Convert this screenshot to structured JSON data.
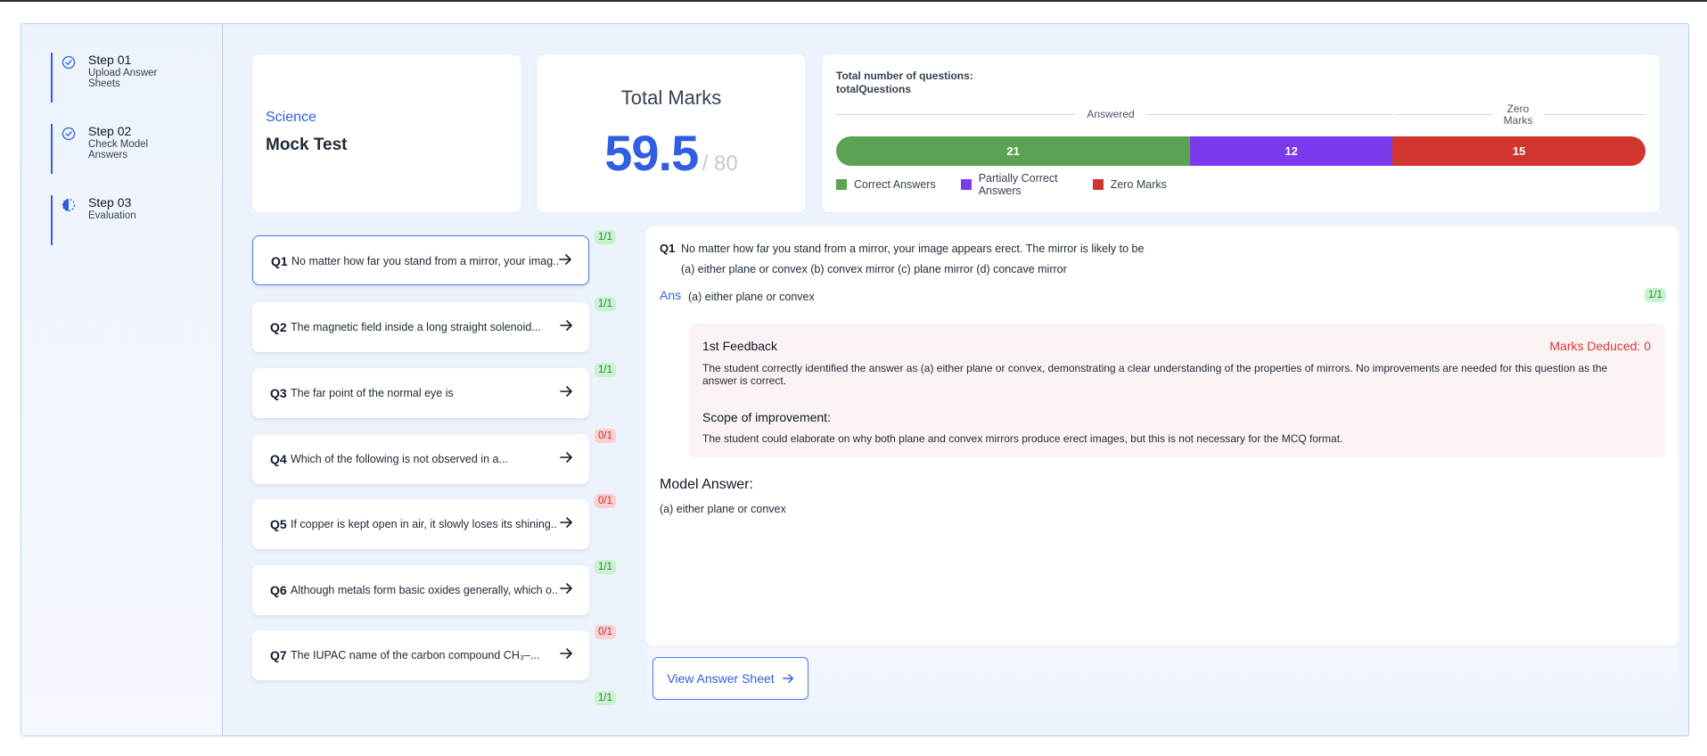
{
  "steps": [
    {
      "title": "Step 01",
      "subtitle": "Upload Answer Sheets",
      "icon": "check-circle-icon"
    },
    {
      "title": "Step 02",
      "subtitle": "Check Model Answers",
      "icon": "check-circle-icon"
    },
    {
      "title": "Step 03",
      "subtitle": "Evaluation",
      "icon": "half-circle-progress-icon"
    }
  ],
  "summary": {
    "subject": "Science",
    "test_name": "Mock Test",
    "total_marks_label": "Total Marks",
    "score": "59.5",
    "out_of": "/ 80"
  },
  "stats": {
    "line1": "Total number of questions:",
    "line2": "totalQuestions",
    "answered_label": "Answered",
    "zero_label": "Zero Marks",
    "bar": [
      {
        "name": "Correct Answers",
        "value": 21,
        "color": "#5ba353"
      },
      {
        "name": "Partially Correct Answers",
        "value": 12,
        "color": "#7c3aed"
      },
      {
        "name": "Zero Marks",
        "value": 15,
        "color": "#d0362e"
      }
    ],
    "legend": [
      "Correct Answers",
      "Partially Correct Answers",
      "Zero Marks"
    ]
  },
  "questions": [
    {
      "num": "Q1",
      "text": "No matter how far you stand from a mirror, your imag...",
      "badge": "1/1",
      "status": "ok"
    },
    {
      "num": "Q2",
      "text": "The magnetic field inside a long straight solenoid...",
      "badge": "1/1",
      "status": "ok"
    },
    {
      "num": "Q3",
      "text": "The far point of the normal eye is",
      "badge": "1/1",
      "status": "ok"
    },
    {
      "num": "Q4",
      "text": "Which of the following is not observed in a...",
      "badge": "0/1",
      "status": "zero"
    },
    {
      "num": "Q5",
      "text": "If copper is kept open in air, it slowly loses its shining...",
      "badge": "0/1",
      "status": "zero"
    },
    {
      "num": "Q6",
      "text": "Although metals form basic oxides generally, which o...",
      "badge": "1/1",
      "status": "ok"
    },
    {
      "num": "Q7",
      "text": "The IUPAC name of the carbon compound CH₃–...",
      "badge": "0/1",
      "status": "zero"
    },
    {
      "badge": "1/1",
      "status": "ok"
    }
  ],
  "detail": {
    "qnum": "Q1",
    "question": "No matter how far you stand from a mirror, your image appears erect. The mirror is likely to be",
    "options": "(a) either plane or convex (b) convex mirror (c) plane mirror (d) concave mirror",
    "ans_label": "Ans",
    "answer": "(a) either plane or convex",
    "badge": "1/1",
    "feedback_title": "1st Feedback",
    "marks_deduced": "Marks Deduced: 0",
    "feedback_text": "The student correctly identified the answer as (a) either plane or convex, demonstrating a clear understanding of the properties of mirrors. No improvements are needed for this question as the answer is correct.",
    "scope_title": "Scope of improvement:",
    "scope_text": "The student could elaborate on why both plane and convex mirrors produce erect images, but this is not necessary for the MCQ format.",
    "model_title": "Model Answer:",
    "model_answer": "(a) either plane or convex"
  },
  "view_button": "View Answer Sheet"
}
